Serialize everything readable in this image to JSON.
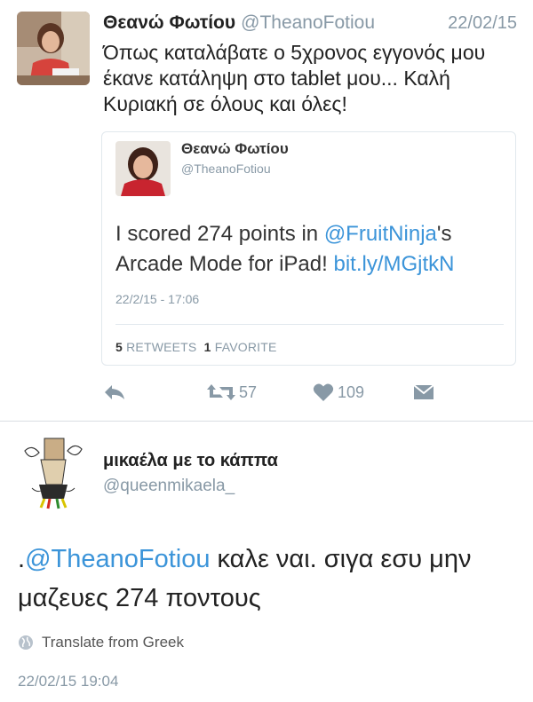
{
  "tweet": {
    "author_name": "Θεανώ Φωτίου",
    "author_handle": "@TheanoFotiou",
    "date": "22/02/15",
    "text": "Όπως καταλάβατε ο 5χρονος εγγονός μου έκανε κατάληψη στο tablet μου... Καλή Κυριακή σε όλους και όλες!",
    "quoted": {
      "author_name": "Θεανώ Φωτίου",
      "author_handle": "@TheanoFotiou",
      "text_before": "I scored 274 points in ",
      "mention": "@FruitNinja",
      "text_middle": "'s Arcade Mode for iPad! ",
      "link": "bit.ly/MGjtkN",
      "timestamp": "22/2/15 - 17:06",
      "retweets_count": "5",
      "retweets_label": "RETWEETS",
      "favorites_count": "1",
      "favorites_label": "FAVORITE"
    },
    "actions": {
      "retweet_count": "57",
      "like_count": "109"
    }
  },
  "reply": {
    "author_name": "μικαέλα με το κάππα",
    "author_handle": "@queenmikaela_",
    "text_prefix": ".",
    "mention": "@TheanoFotiou",
    "text": " καλε ναι. σιγα εσυ μην μαζευες 274 ποντους",
    "translate_label": "Translate from Greek",
    "timestamp": "22/02/15 19:04"
  },
  "colors": {
    "link": "#3b94d9",
    "secondary_text": "#8899a6",
    "border": "#e1e8ed"
  }
}
